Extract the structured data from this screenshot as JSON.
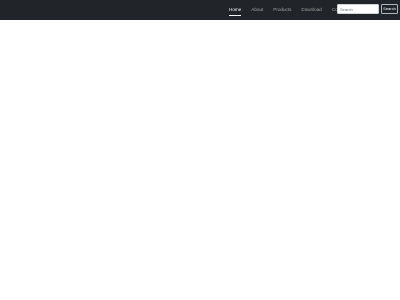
{
  "navbar": {
    "links": [
      {
        "label": "Home",
        "active": true
      },
      {
        "label": "About",
        "active": false
      },
      {
        "label": "Products",
        "active": false
      },
      {
        "label": "Download",
        "active": false
      },
      {
        "label": "Contact Us",
        "active": false
      }
    ],
    "search": {
      "placeholder": "Search",
      "value": "",
      "button_label": "Search"
    }
  },
  "colors": {
    "navbar_background": "#212529",
    "page_background": "#ffffff"
  }
}
